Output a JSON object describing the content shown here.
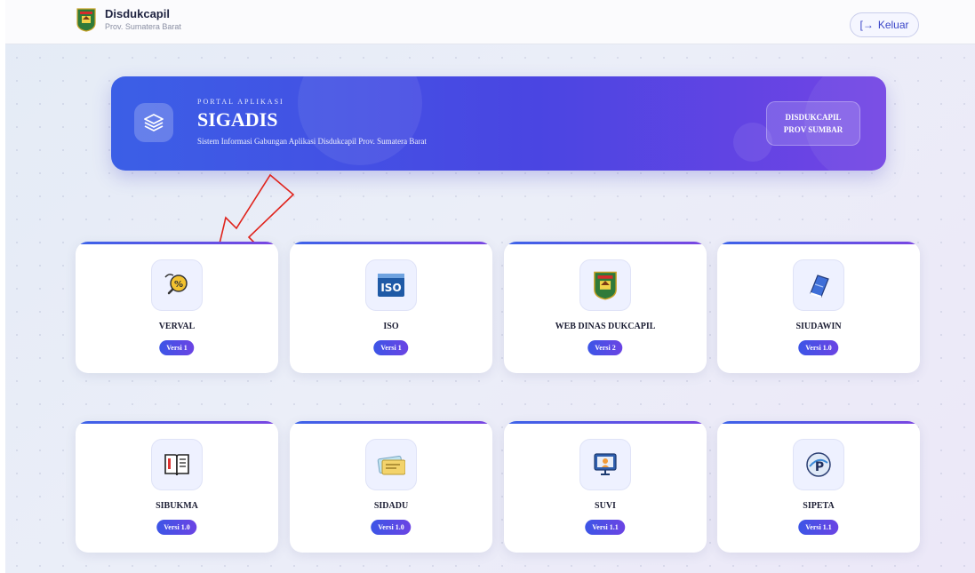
{
  "header": {
    "brand_name": "Disdukcapil",
    "brand_sub": "Prov. Sumatera Barat",
    "logout_label": "Keluar",
    "logout_icon": "logout-icon"
  },
  "hero": {
    "eyebrow": "PORTAL APLIKASI",
    "title": "SIGADIS",
    "subtitle": "Sistem Informasi Gabungan Aplikasi Disdukcapil Prov. Sumatera Barat",
    "badge_line1": "DISDUKCAPIL",
    "badge_line2": "PROV SUMBAR",
    "icon": "layers-icon"
  },
  "apps": [
    {
      "title": "VERVAL",
      "version": "Versi 1",
      "icon": "verval-icon"
    },
    {
      "title": "ISO",
      "version": "Versi 1",
      "icon": "iso-icon"
    },
    {
      "title": "WEB DINAS DUKCAPIL",
      "version": "Versi 2",
      "icon": "province-emblem-icon"
    },
    {
      "title": "SIUDAWIN",
      "version": "Versi 1.0",
      "icon": "book-icon"
    },
    {
      "title": "SIBUKMA",
      "version": "Versi 1.0",
      "icon": "open-book-icon"
    },
    {
      "title": "SIDADU",
      "version": "Versi 1.0",
      "icon": "id-card-icon"
    },
    {
      "title": "SUVI",
      "version": "Versi 1.1",
      "icon": "monitor-icon"
    },
    {
      "title": "SIPETA",
      "version": "Versi 1.1",
      "icon": "sipeta-icon"
    }
  ],
  "colors": {
    "accent": "#4a45e2",
    "hero_start": "#3b5fe6",
    "hero_end": "#7344e4",
    "arrow": "#e0231c"
  }
}
